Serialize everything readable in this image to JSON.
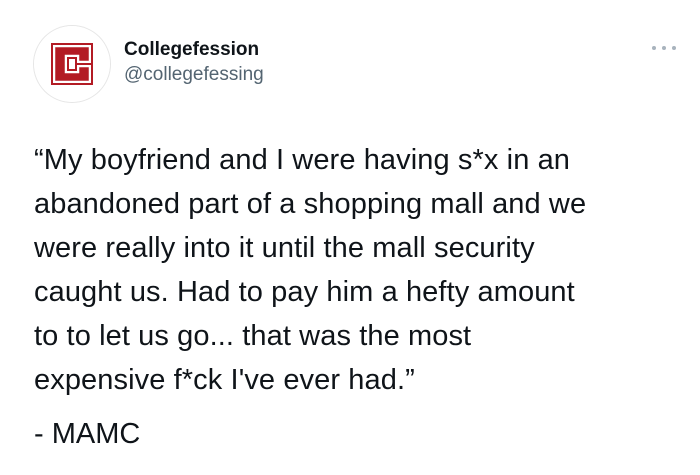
{
  "tweet": {
    "author": {
      "display_name": "Collegefession",
      "handle": "@collegefessing",
      "avatar_letter": "C",
      "avatar_color": "#b31b24"
    },
    "more_icon": "more-options-icon",
    "text": "“My boyfriend and I were having s*x in an\nabandoned part of a shopping mall and we\nwere really into it until the mall security\ncaught us. Had to pay him a hefty amount\nto  to let us go... that was the most\nexpensive f*ck I've ever had.”",
    "signature": "- MAMC"
  }
}
